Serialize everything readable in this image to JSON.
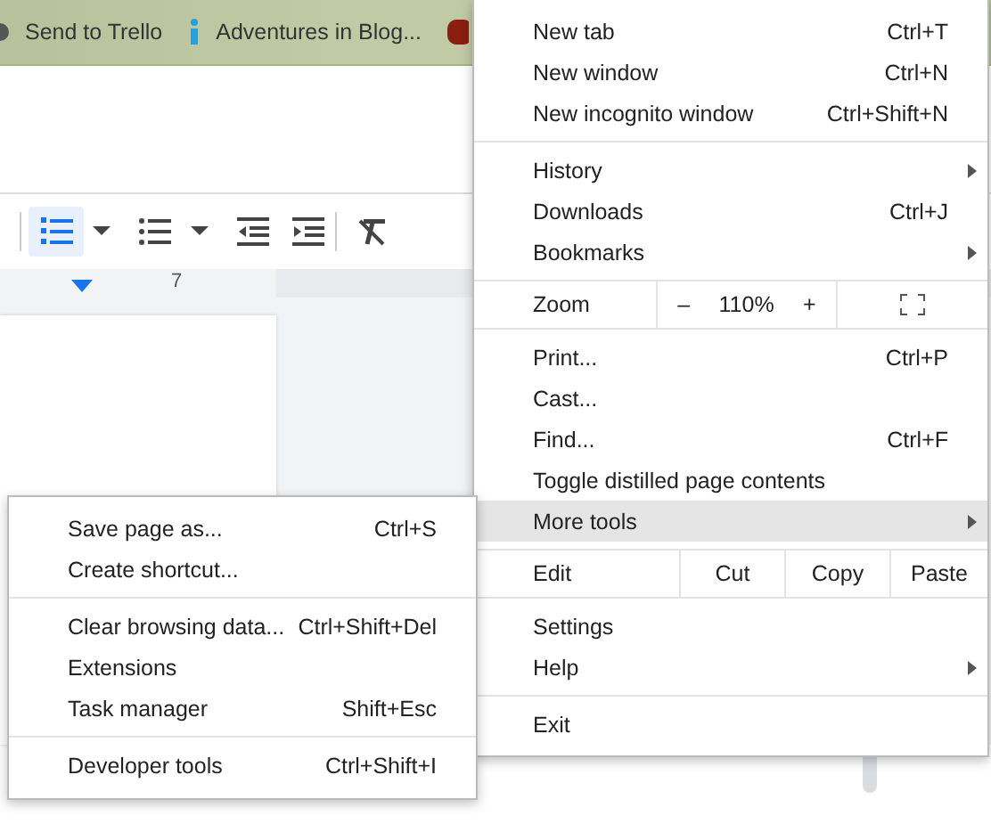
{
  "bookmarks": [
    {
      "label": "Send to Trello"
    },
    {
      "label": "Adventures in Blog..."
    }
  ],
  "toolbar": {
    "items": [
      {
        "kind": "numbered-list",
        "selected": true
      },
      {
        "kind": "dropdown",
        "selected": false
      },
      {
        "kind": "bulleted-list",
        "selected": false
      },
      {
        "kind": "dropdown",
        "selected": false
      },
      {
        "kind": "decrease-indent",
        "selected": false
      },
      {
        "kind": "increase-indent",
        "selected": false
      },
      {
        "kind": "clear-formatting",
        "selected": false
      }
    ]
  },
  "ruler": {
    "label": "7"
  },
  "menu": {
    "sections": [
      [
        {
          "kind": "item",
          "label": "New tab",
          "shortcut": "Ctrl+T",
          "submenu": false,
          "highlighted": false
        },
        {
          "kind": "item",
          "label": "New window",
          "shortcut": "Ctrl+N",
          "submenu": false,
          "highlighted": false
        },
        {
          "kind": "item",
          "label": "New incognito window",
          "shortcut": "Ctrl+Shift+N",
          "submenu": false,
          "highlighted": false
        }
      ],
      [
        {
          "kind": "item",
          "label": "History",
          "submenu": true,
          "highlighted": false
        },
        {
          "kind": "item",
          "label": "Downloads",
          "shortcut": "Ctrl+J",
          "submenu": false,
          "highlighted": false
        },
        {
          "kind": "item",
          "label": "Bookmarks",
          "submenu": true,
          "highlighted": false
        }
      ],
      [
        {
          "kind": "zoom",
          "label": "Zoom",
          "minus": "–",
          "value": "110%",
          "plus": "+"
        }
      ],
      [
        {
          "kind": "item",
          "label": "Print...",
          "shortcut": "Ctrl+P",
          "submenu": false,
          "highlighted": false
        },
        {
          "kind": "item",
          "label": "Cast...",
          "submenu": false,
          "highlighted": false
        },
        {
          "kind": "item",
          "label": "Find...",
          "shortcut": "Ctrl+F",
          "submenu": false,
          "highlighted": false
        },
        {
          "kind": "item",
          "label": "Toggle distilled page contents",
          "submenu": false,
          "highlighted": false
        },
        {
          "kind": "item",
          "label": "More tools",
          "submenu": true,
          "highlighted": true
        }
      ],
      [
        {
          "kind": "edit",
          "label": "Edit",
          "buttons": [
            "Cut",
            "Copy",
            "Paste"
          ]
        }
      ],
      [
        {
          "kind": "item",
          "label": "Settings",
          "submenu": false,
          "highlighted": false
        },
        {
          "kind": "item",
          "label": "Help",
          "submenu": true,
          "highlighted": false
        }
      ],
      [
        {
          "kind": "item",
          "label": "Exit",
          "submenu": false,
          "highlighted": false
        }
      ]
    ]
  },
  "submenu": {
    "sections": [
      [
        {
          "label": "Save page as...",
          "shortcut": "Ctrl+S"
        },
        {
          "label": "Create shortcut..."
        }
      ],
      [
        {
          "label": "Clear browsing data...",
          "shortcut": "Ctrl+Shift+Del"
        },
        {
          "label": "Extensions"
        },
        {
          "label": "Task manager",
          "shortcut": "Shift+Esc"
        }
      ],
      [
        {
          "label": "Developer tools",
          "shortcut": "Ctrl+Shift+I"
        }
      ]
    ]
  }
}
